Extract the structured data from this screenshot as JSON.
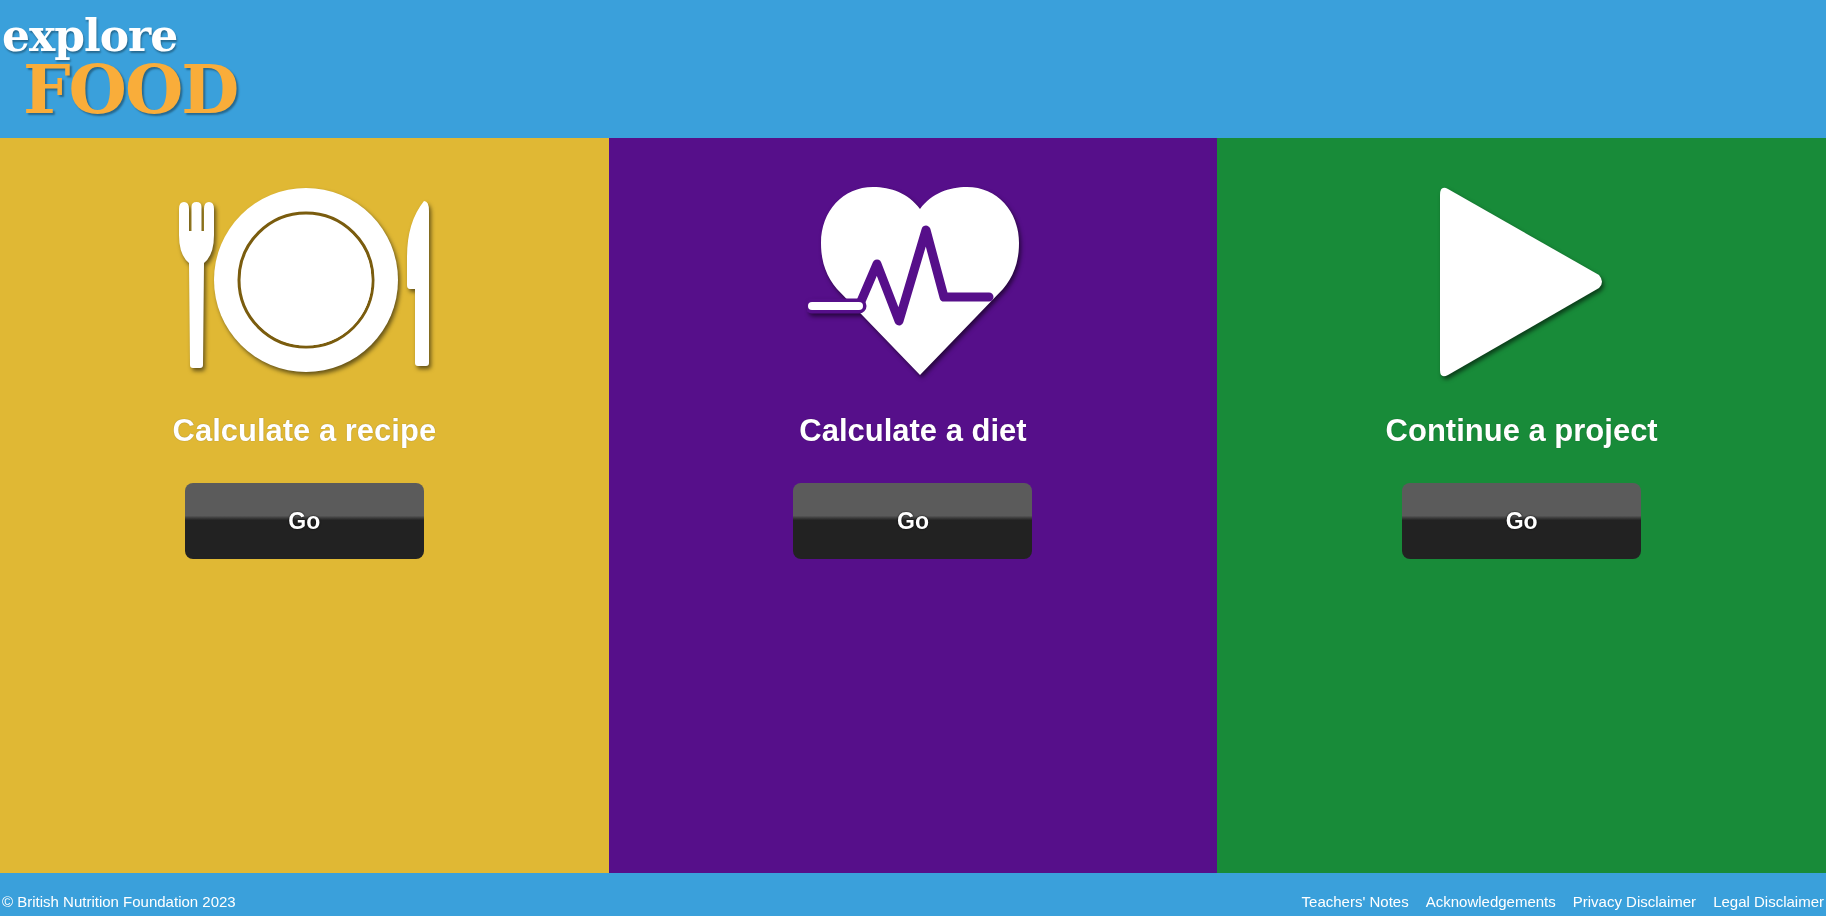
{
  "header": {
    "logo": {
      "top": "explore",
      "bottom": "FOOD"
    }
  },
  "panels": [
    {
      "kind": "cutlery",
      "color": "#e0b834",
      "title": "Calculate a recipe",
      "button": "Go"
    },
    {
      "kind": "heart",
      "color": "#560f8a",
      "title": "Calculate a diet",
      "button": "Go"
    },
    {
      "kind": "play",
      "color": "#188b39",
      "title": "Continue a project",
      "button": "Go"
    }
  ],
  "footer": {
    "copyright": "© British Nutrition Foundation 2023",
    "links": [
      "Teachers' Notes",
      "Acknowledgements",
      "Privacy Disclaimer",
      "Legal Disclaimer"
    ]
  }
}
